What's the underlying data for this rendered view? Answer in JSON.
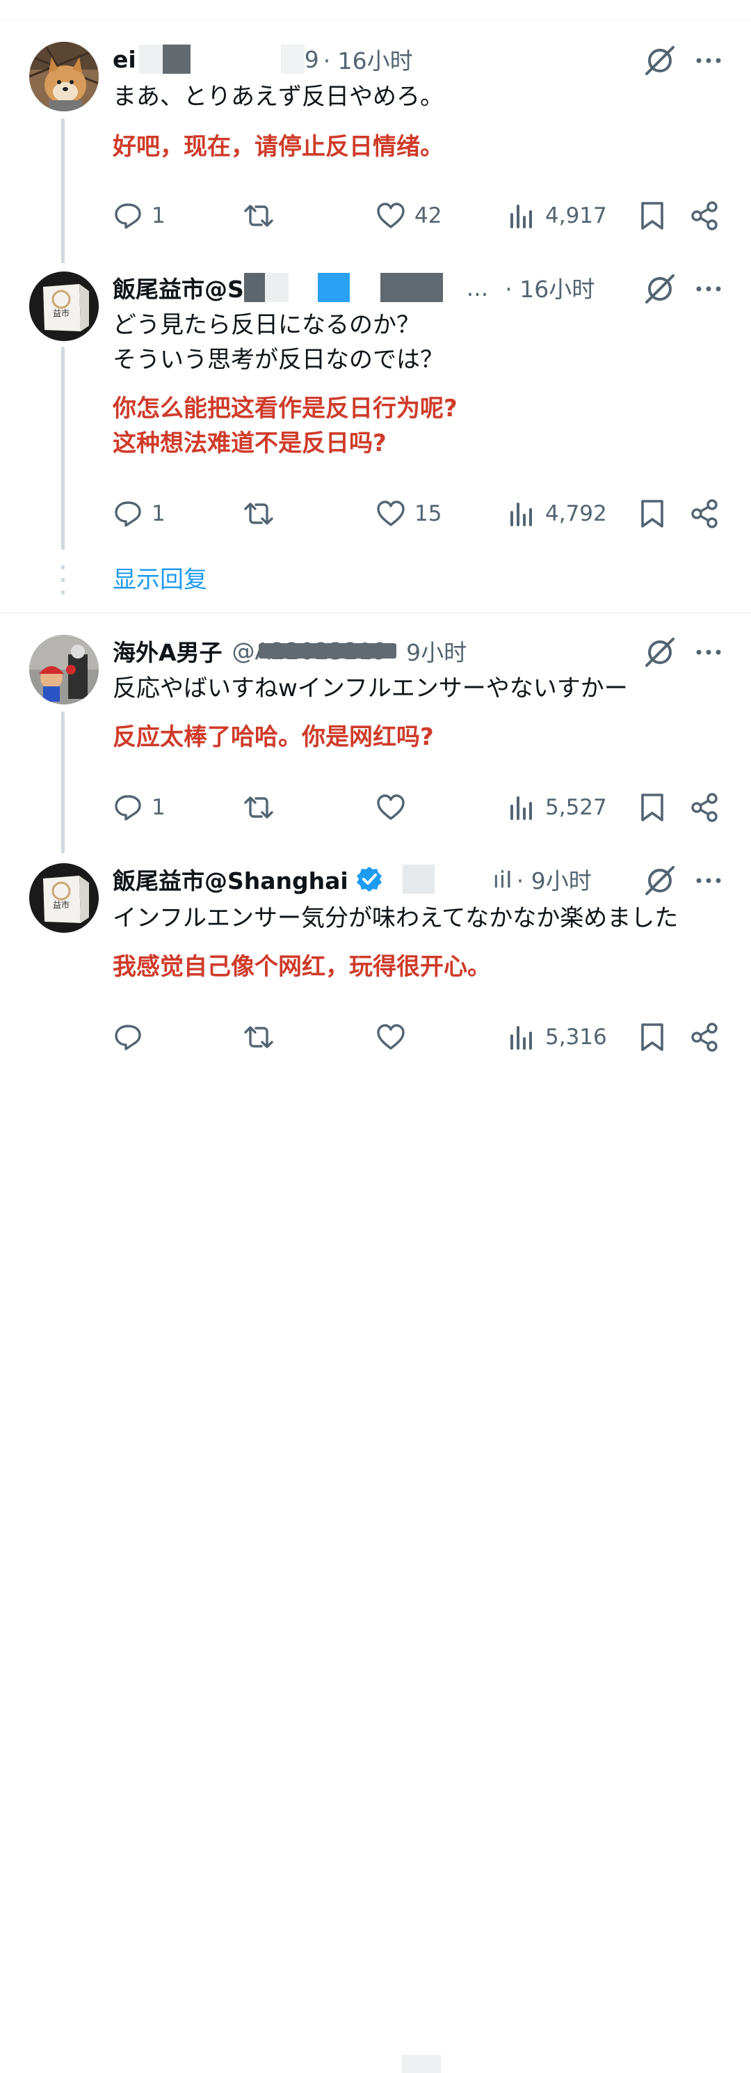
{
  "tweets": [
    {
      "name": "ei",
      "handle": "9",
      "time": "· 16小时",
      "text_ja": [
        "まあ、とりあえず反日やめろ。"
      ],
      "text_zh": [
        "好吧，现在，请停止反日情绪。"
      ],
      "replies": "1",
      "retweets": "",
      "likes": "42",
      "views": "4,917"
    },
    {
      "name": "飯尾益市@S",
      "handle": "...",
      "time": "· 16小时",
      "text_ja": [
        "どう見たら反日になるのか？",
        "そういう思考が反日なのでは？"
      ],
      "text_zh": [
        "你怎么能把这看作是反日行为呢?",
        "这种想法难道不是反日吗?"
      ],
      "replies": "1",
      "retweets": "",
      "likes": "15",
      "views": "4,792"
    },
    {
      "name": "海外A男子",
      "handle": "@A22023219",
      "time": "· 9小时",
      "text_ja": [
        "反応やばいすねwインフルエンサーやないすかー"
      ],
      "text_zh": [
        "反应太棒了哈哈。你是网红吗?"
      ],
      "replies": "1",
      "retweets": "",
      "likes": "",
      "views": "5,527"
    },
    {
      "name": "飯尾益市@Shanghai",
      "handle": "ıiI",
      "time": "· 9小时",
      "text_ja": [
        "インフルエンサー気分が味わえてなかなか楽めました"
      ],
      "text_zh": [
        "我感觉自己像个网红，玩得很开心。"
      ],
      "replies": "",
      "retweets": "",
      "likes": "",
      "views": "5,316"
    }
  ],
  "show_replies_label": "显示回复",
  "avatar_shop_label": "益市",
  "icons": [
    "reply-icon",
    "retweet-icon",
    "like-icon",
    "views-icon",
    "bookmark-icon",
    "share-icon",
    "grok-icon",
    "more-icon",
    "verified-badge-icon"
  ],
  "colors": {
    "accent": "#1d9bf0",
    "translation": "#cf3b2a",
    "muted": "#536471",
    "thread": "#cfd9de"
  }
}
